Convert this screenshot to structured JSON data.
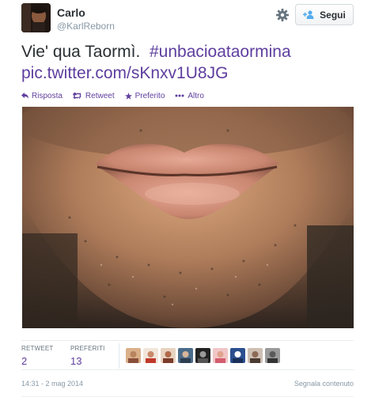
{
  "author": {
    "name": "Carlo",
    "handle": "@KarlReborn"
  },
  "follow_button": {
    "label": "Segui",
    "icon": "follow-user-icon"
  },
  "settings_icon": "gear-icon",
  "tweet": {
    "text": "Vie' qua Taormì.",
    "hashtag": "#unbacioataormina",
    "photo_link": "pic.twitter.com/sKnxv1U8JG"
  },
  "actions": [
    {
      "label": "Risposta",
      "icon": "reply-icon"
    },
    {
      "label": "Retweet",
      "icon": "retweet-icon"
    },
    {
      "label": "Preferito",
      "icon": "star-icon"
    },
    {
      "label": "Altro",
      "icon": "more-icon"
    }
  ],
  "stats": {
    "retweets_label": "RETWEET",
    "retweets_value": "2",
    "favorites_label": "PREFERITI",
    "favorites_value": "13"
  },
  "favoriters_count_shown": 9,
  "timestamp": "14:31 - 2 mag 2014",
  "report_link": "Segnala contenuto",
  "colors": {
    "link": "#5e3e9e",
    "text": "#292f33",
    "muted": "#8899a6"
  }
}
